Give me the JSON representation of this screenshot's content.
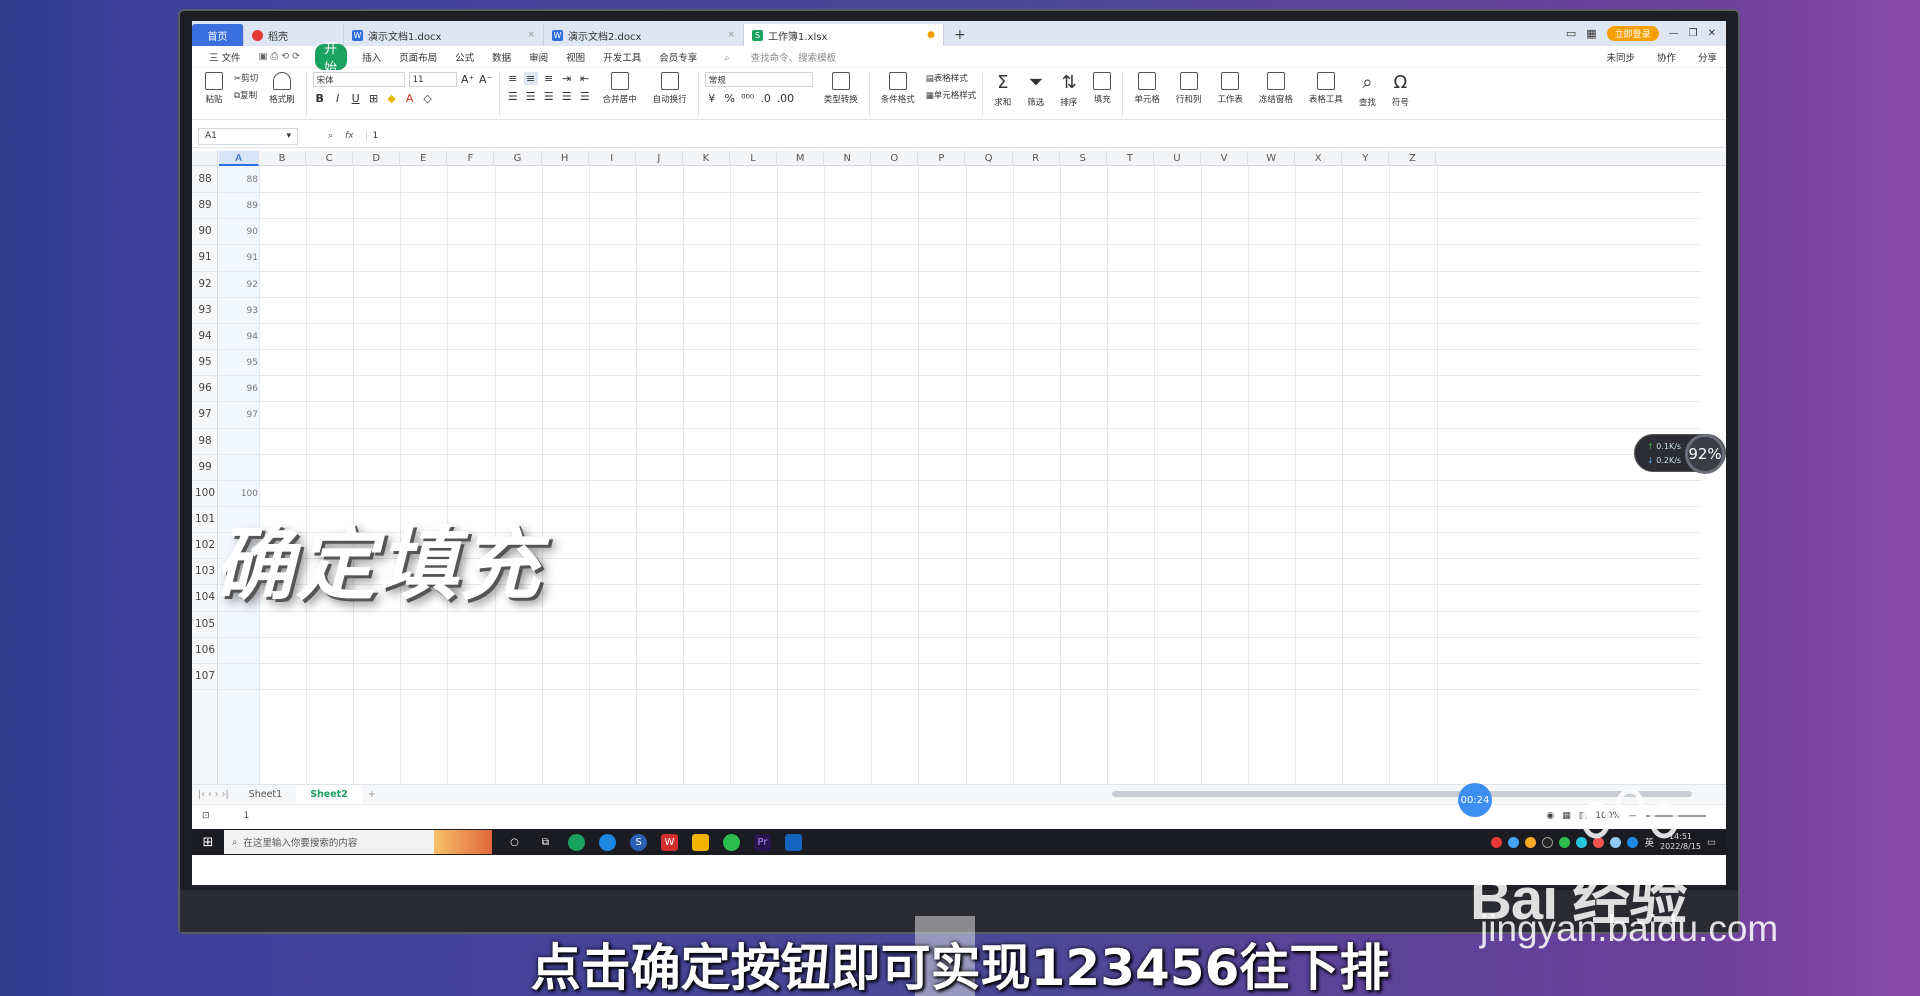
{
  "titlebar": {
    "tabs": [
      {
        "label": "首页",
        "kind": "home"
      },
      {
        "label": "稻壳",
        "kind": "docer"
      },
      {
        "label": "演示文档1.docx",
        "kind": "word"
      },
      {
        "label": "演示文档2.docx",
        "kind": "word"
      },
      {
        "label": "工作簿1.xlsx",
        "kind": "sheet",
        "active": true
      }
    ],
    "login_label": "立即登录"
  },
  "menubar": {
    "file": "三 文件",
    "items": [
      "开始",
      "插入",
      "页面布局",
      "公式",
      "数据",
      "审阅",
      "视图",
      "开发工具",
      "会员专享"
    ],
    "search_placeholder": "查找命令、搜索模板",
    "right": [
      "未同步",
      "协作",
      "分享"
    ]
  },
  "ribbon": {
    "paste": "粘贴",
    "cut": "剪切",
    "copy": "复制",
    "format_painter": "格式刷",
    "font_name": "宋体",
    "font_size": "11",
    "merge": "合并居中",
    "wrap": "自动换行",
    "number_format": "常规",
    "convert": "类型转换",
    "cond_format": "条件格式",
    "table_style": "表格样式",
    "cell_style": "单元格样式",
    "sum": "求和",
    "filter": "筛选",
    "sort": "排序",
    "fill": "填充",
    "cell": "单元格",
    "rowcol": "行和列",
    "worksheet": "工作表",
    "freeze": "冻结窗格",
    "table_tools": "表格工具",
    "find": "查找",
    "symbol": "符号"
  },
  "formula_bar": {
    "name_box": "A1",
    "fx": "fx",
    "value": "1"
  },
  "columns": [
    "A",
    "B",
    "C",
    "D",
    "E",
    "F",
    "G",
    "H",
    "I",
    "J",
    "K",
    "L",
    "M",
    "N",
    "O",
    "P",
    "Q",
    "R",
    "S",
    "T",
    "U",
    "V",
    "W",
    "X",
    "Y",
    "Z"
  ],
  "rows": [
    {
      "num": "88",
      "a": "88"
    },
    {
      "num": "89",
      "a": "89"
    },
    {
      "num": "90",
      "a": "90"
    },
    {
      "num": "91",
      "a": "91"
    },
    {
      "num": "92",
      "a": "92"
    },
    {
      "num": "93",
      "a": "93"
    },
    {
      "num": "94",
      "a": "94"
    },
    {
      "num": "95",
      "a": "95"
    },
    {
      "num": "96",
      "a": "96"
    },
    {
      "num": "97",
      "a": "97"
    },
    {
      "num": "98",
      "a": ""
    },
    {
      "num": "99",
      "a": ""
    },
    {
      "num": "100",
      "a": "100"
    },
    {
      "num": "101",
      "a": ""
    },
    {
      "num": "102",
      "a": ""
    },
    {
      "num": "103",
      "a": ""
    },
    {
      "num": "104",
      "a": ""
    },
    {
      "num": "105",
      "a": ""
    },
    {
      "num": "106",
      "a": ""
    },
    {
      "num": "107",
      "a": ""
    }
  ],
  "sheets": [
    "Sheet1",
    "Sheet2"
  ],
  "status": {
    "cell_value": "1",
    "zoom": "100%"
  },
  "taskbar": {
    "search_placeholder": "在这里输入你要搜索的内容",
    "lang": "英",
    "date": "2022/8/15",
    "time": "14:51"
  },
  "network_widget": {
    "up": "0.1K/s",
    "down": "0.2K/s",
    "percent": "92%"
  },
  "timer": "00:24",
  "overlay_title": "确定填充",
  "subtitle": "点击确定按钮即可实现123456往下排",
  "watermark": {
    "brand": "Bai 经验",
    "url": "jingyan.baidu.com"
  },
  "colors": {
    "accent_green": "#1aa260",
    "home_tab": "#3b6fe0",
    "login": "#f59f00"
  }
}
